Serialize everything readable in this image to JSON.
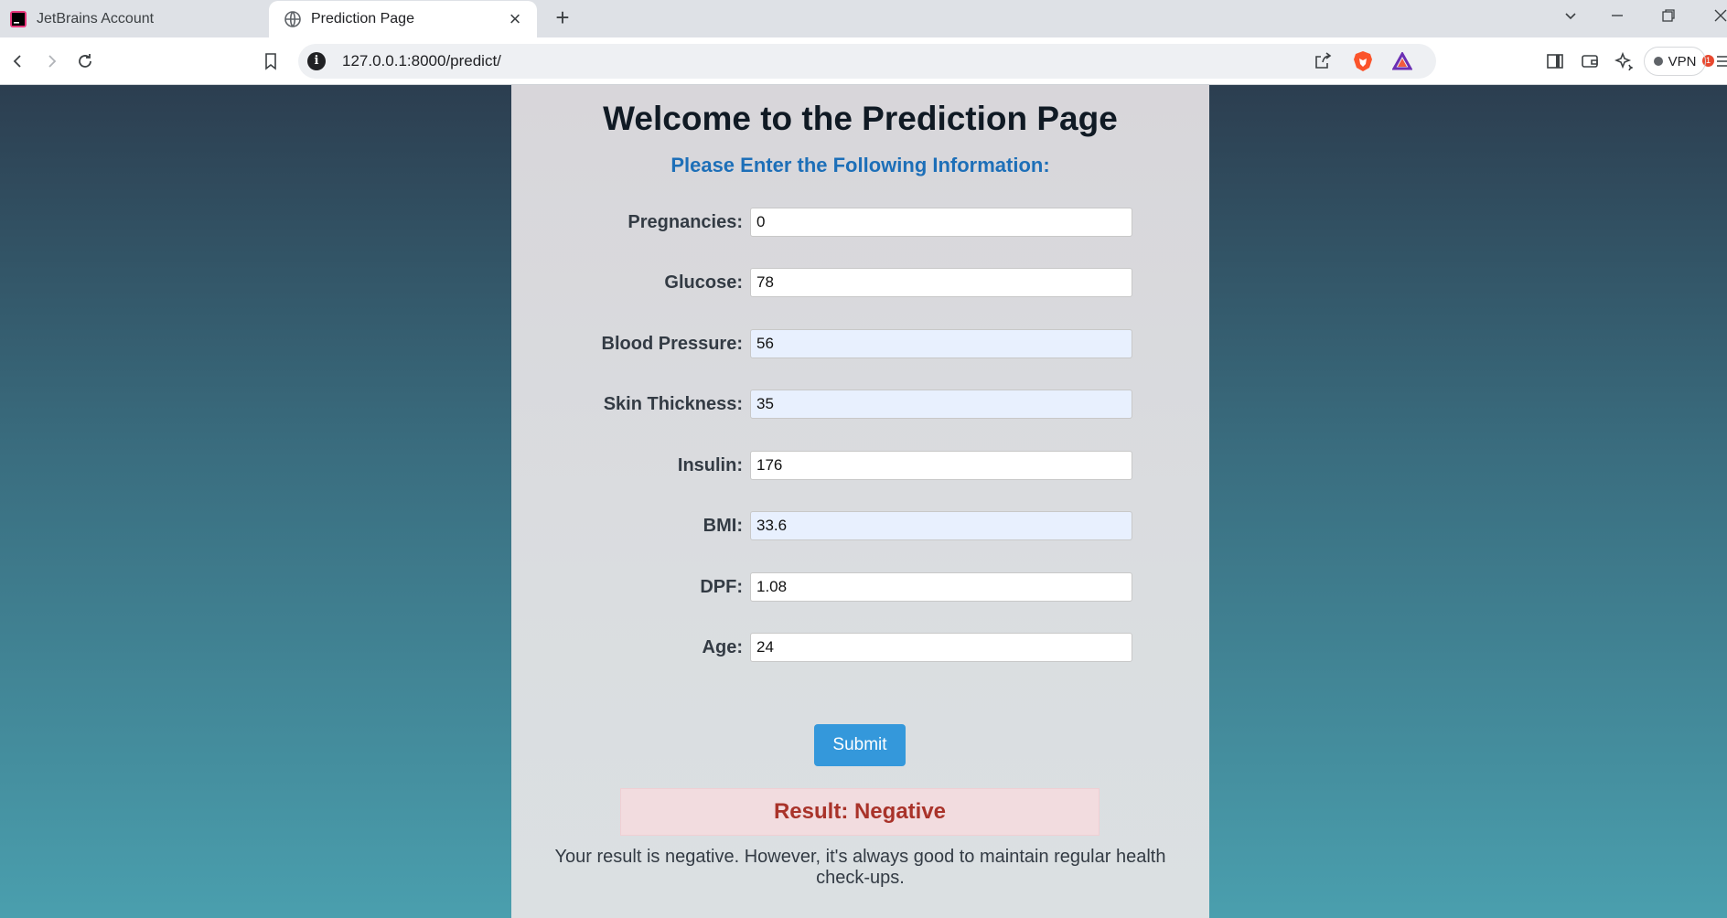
{
  "browser": {
    "tabs": [
      {
        "label": "JetBrains Account",
        "active": false
      },
      {
        "label": "Prediction Page",
        "active": true
      }
    ],
    "url": "127.0.0.1:8000/predict/",
    "vpn_label": "VPN",
    "rewards_badge": "1"
  },
  "page": {
    "heading": "Welcome to the Prediction Page",
    "subheading": "Please Enter the Following Information:",
    "fields": [
      {
        "label": "Pregnancies:",
        "value": "0"
      },
      {
        "label": "Glucose:",
        "value": "78"
      },
      {
        "label": "Blood Pressure:",
        "value": "56"
      },
      {
        "label": "Skin Thickness:",
        "value": "35"
      },
      {
        "label": "Insulin:",
        "value": "176"
      },
      {
        "label": "BMI:",
        "value": "33.6"
      },
      {
        "label": "DPF:",
        "value": "1.08"
      },
      {
        "label": "Age:",
        "value": "24"
      }
    ],
    "submit_label": "Submit",
    "result": "Result: Negative",
    "result_message": "Your result is negative. However, it's always good to maintain regular health check-ups."
  },
  "colors": {
    "accent": "#3498db",
    "subheading": "#1d6fb8",
    "result_text": "#a9332a",
    "result_bg": "#f2dcdf"
  }
}
